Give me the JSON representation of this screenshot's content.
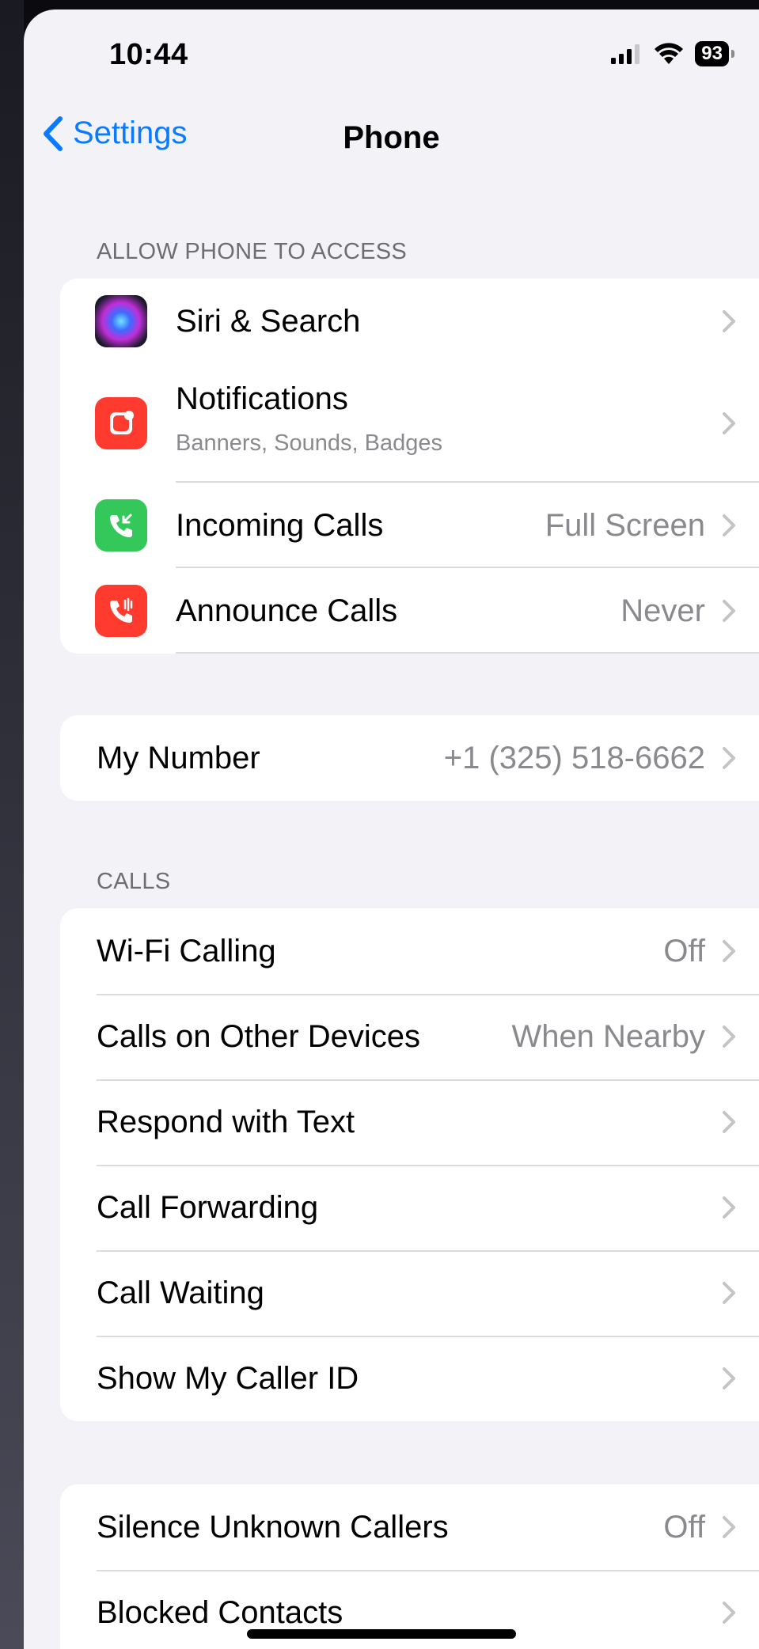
{
  "status_bar": {
    "time": "10:44",
    "battery": "93",
    "icons": [
      "signal-icon",
      "wifi-icon",
      "battery-icon"
    ]
  },
  "nav": {
    "back_label": "Settings",
    "title": "Phone"
  },
  "sections": {
    "access_header": "ALLOW PHONE TO ACCESS",
    "calls_header": "CALLS"
  },
  "access_items": [
    {
      "label": "Siri & Search",
      "icon": "siri-icon"
    },
    {
      "label": "Notifications",
      "sublabel": "Banners, Sounds, Badges",
      "icon": "notifications-icon"
    },
    {
      "label": "Incoming Calls",
      "value": "Full Screen",
      "icon": "incoming-calls-icon"
    },
    {
      "label": "Announce Calls",
      "value": "Never",
      "icon": "announce-calls-icon"
    }
  ],
  "my_number": {
    "label": "My Number",
    "value": "+1 (325) 518-6662"
  },
  "calls_items": [
    {
      "label": "Wi-Fi Calling",
      "value": "Off"
    },
    {
      "label": "Calls on Other Devices",
      "value": "When Nearby"
    },
    {
      "label": "Respond with Text",
      "value": ""
    },
    {
      "label": "Call Forwarding",
      "value": ""
    },
    {
      "label": "Call Waiting",
      "value": ""
    },
    {
      "label": "Show My Caller ID",
      "value": ""
    }
  ],
  "blocking_items": [
    {
      "label": "Silence Unknown Callers",
      "value": "Off"
    },
    {
      "label": "Blocked Contacts",
      "value": ""
    }
  ],
  "colors": {
    "accent": "#0a7aff",
    "notifications": "#ff3b30",
    "incoming_calls": "#34c759",
    "announce_calls": "#ff3b30",
    "background": "#f2f2f7"
  }
}
